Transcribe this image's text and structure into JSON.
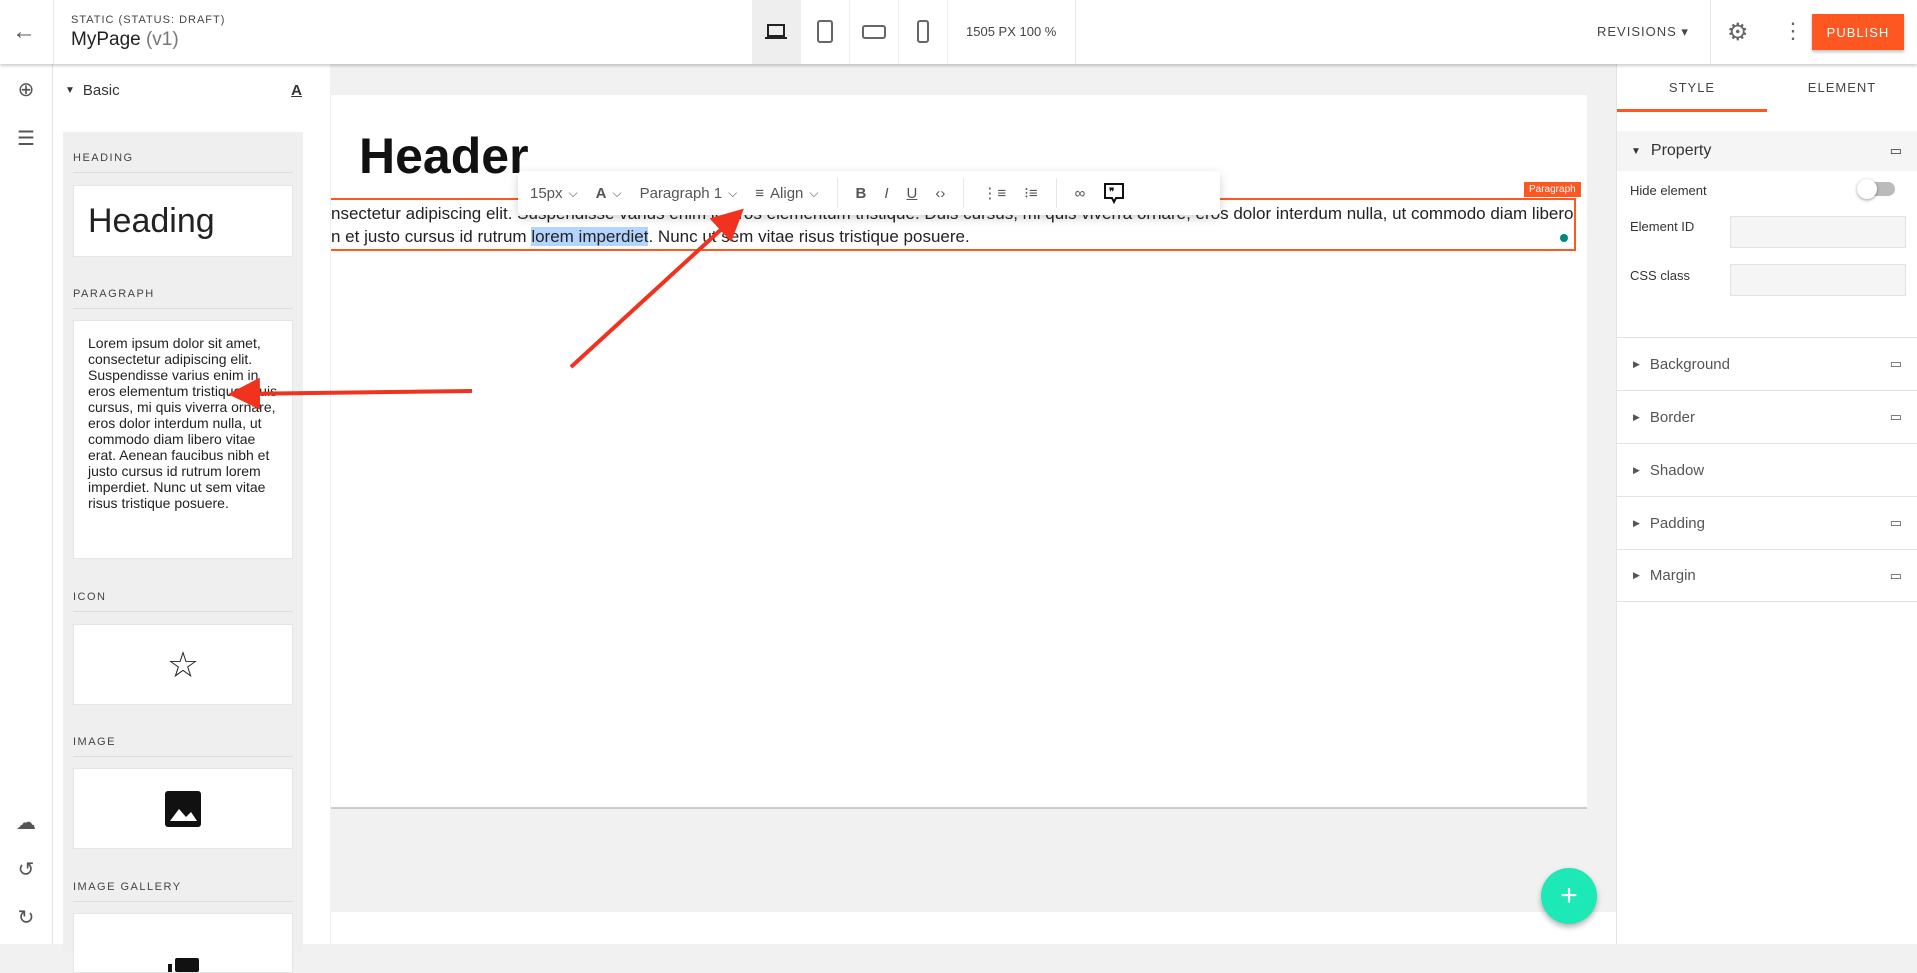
{
  "topbar": {
    "status": "STATIC (STATUS: DRAFT)",
    "page_name": "MyPage",
    "version": "(v1)",
    "dimensions": "1505 PX  100 %",
    "revisions": "REVISIONS ▾",
    "publish": "PUBLISH",
    "devices": [
      "desktop",
      "tablet",
      "tablet-landscape",
      "mobile"
    ],
    "active_device": "desktop"
  },
  "blocks": {
    "group": "Basic",
    "items": [
      {
        "label": "HEADING",
        "preview": "Heading"
      },
      {
        "label": "PARAGRAPH",
        "preview": "Lorem ipsum dolor sit amet, consectetur adipiscing elit. Suspendisse varius enim in eros elementum tristique. Duis cursus, mi quis viverra ornare, eros dolor interdum nulla, ut commodo diam libero vitae erat. Aenean faucibus nibh et justo cursus id rutrum lorem imperdiet. Nunc ut sem vitae risus tristique posuere."
      },
      {
        "label": "ICON",
        "preview": "star-icon"
      },
      {
        "label": "IMAGE",
        "preview": "image-icon"
      },
      {
        "label": "IMAGE GALLERY",
        "preview": "gallery-icon"
      }
    ]
  },
  "canvas": {
    "header": "Header",
    "para_line1": "nsectetur adipiscing elit. Suspendisse varius enim in eros elementum tristique. Duis cursus, mi quis viverra ornare, eros dolor interdum nulla, ut commodo diam libero",
    "para_line2_a": "n et justo cursus id rutrum ",
    "para_selected": "lorem imperdiet",
    "para_line2_b": ". Nunc ut sem vitae risus tristique posuere.",
    "tag": "Paragraph"
  },
  "toolbar": {
    "font_size": "15px",
    "text_style": "Paragraph 1",
    "align": "Align"
  },
  "right_panel": {
    "tabs": [
      "STYLE",
      "ELEMENT"
    ],
    "active_tab": "STYLE",
    "property": "Property",
    "hide_element": "Hide element",
    "hide_element_on": false,
    "element_id": "Element ID",
    "element_id_value": "",
    "css_class": "CSS class",
    "css_class_value": "",
    "sections": [
      "Background",
      "Border",
      "Shadow",
      "Padding",
      "Margin"
    ]
  },
  "colors": {
    "accent": "#ff5722",
    "fab": "#1de9b6",
    "annotation_arrow": "#f0321e"
  }
}
